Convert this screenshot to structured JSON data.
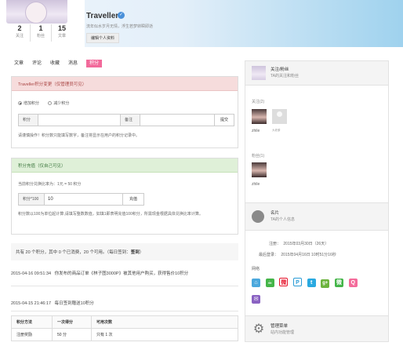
{
  "profile": {
    "name": "Traveller",
    "motto": "流年似水岁月无情，浮生若梦转瞬即逝",
    "edit_label": "编辑个人资料",
    "stats": [
      {
        "value": "2",
        "label": "关注"
      },
      {
        "value": "1",
        "label": "粉丝"
      },
      {
        "value": "15",
        "label": "文章"
      }
    ]
  },
  "tabs": [
    {
      "label": "文章",
      "active": false
    },
    {
      "label": "评论",
      "active": false
    },
    {
      "label": "收藏",
      "active": false
    },
    {
      "label": "消息",
      "active": false
    },
    {
      "label": "积分",
      "active": true
    }
  ],
  "credit_change": {
    "title": "Traveller积分变更（仅管理员可见）",
    "radio_add": "增加积分",
    "radio_sub": "减少积分",
    "label_points": "积分",
    "label_note": "备注",
    "submit": "提交",
    "note": "请谨慎操作！积分数只能填写数字，备注将显示在用户的积分记录中。"
  },
  "recharge": {
    "title": "积分充值（仅自己可见）",
    "rate": "当前积分兑换比率为：1元 = 50 积分",
    "label": "积分*100",
    "value": "10",
    "button": "充值",
    "note": "积分数以100为单位起计算,请填写整数数值，如填1即表明充值100积分，所需现金根据具体兑换比率计算。"
  },
  "summary": {
    "text": "共有 20 个积分，其中 0 个已消费，20 个可用。（每日签到：",
    "checked": "签到",
    "tail": "）"
  },
  "logs": [
    {
      "time": "2015-04-16 09:51:34",
      "text": "你发布的商品订单《林子图3000P》被其他用户购买，获得售价10积分"
    },
    {
      "time": "2015-04-15 21:46:17",
      "text": "每日签到赠送10积分"
    }
  ],
  "rules": {
    "headers": [
      "积分方法",
      "一次得分",
      "可用次数"
    ],
    "rows": [
      [
        "注册奖励",
        "50 分",
        "只有 1 次"
      ]
    ]
  },
  "sidebar": {
    "follow_title": "关注/粉丝",
    "follow_sub": "TA的关注和粉丝",
    "following_label": "关注(2)",
    "following": [
      {
        "name": "zhile"
      },
      {
        "name": "大老爹"
      }
    ],
    "fans_label": "粉丝(1)",
    "fans": [
      {
        "name": "zhile"
      }
    ],
    "card_title": "名片",
    "card_sub": "TA的个人信息",
    "register_label": "注册：",
    "register_value": "2015年03月30日（26天）",
    "last_login_label": "最后登录：",
    "last_login_value": "2015年04月16日 10时51分16秒",
    "social_label": "网络",
    "admin_title": "管理菜单",
    "admin_sub": "站内功能管理"
  },
  "social_icons": [
    {
      "name": "home-icon",
      "color": "#4ca8dd",
      "glyph": "⌂"
    },
    {
      "name": "wechat-cup-icon",
      "color": "#44b549",
      "glyph": "☕"
    },
    {
      "name": "weibo-icon",
      "color": "#e6162d",
      "glyph": "微"
    },
    {
      "name": "qq-weibo-icon",
      "color": "#2b9cd6",
      "glyph": "P"
    },
    {
      "name": "twitter-icon",
      "color": "#2aa9e0",
      "glyph": "t"
    },
    {
      "name": "google-plus-icon",
      "color": "#6cb33e",
      "glyph": "g+"
    },
    {
      "name": "wechat-icon",
      "color": "#44b549",
      "glyph": "微"
    },
    {
      "name": "qq-icon",
      "color": "#f46b9a",
      "glyph": "Q"
    },
    {
      "name": "mail-icon",
      "color": "#8a62c2",
      "glyph": "✉"
    }
  ]
}
